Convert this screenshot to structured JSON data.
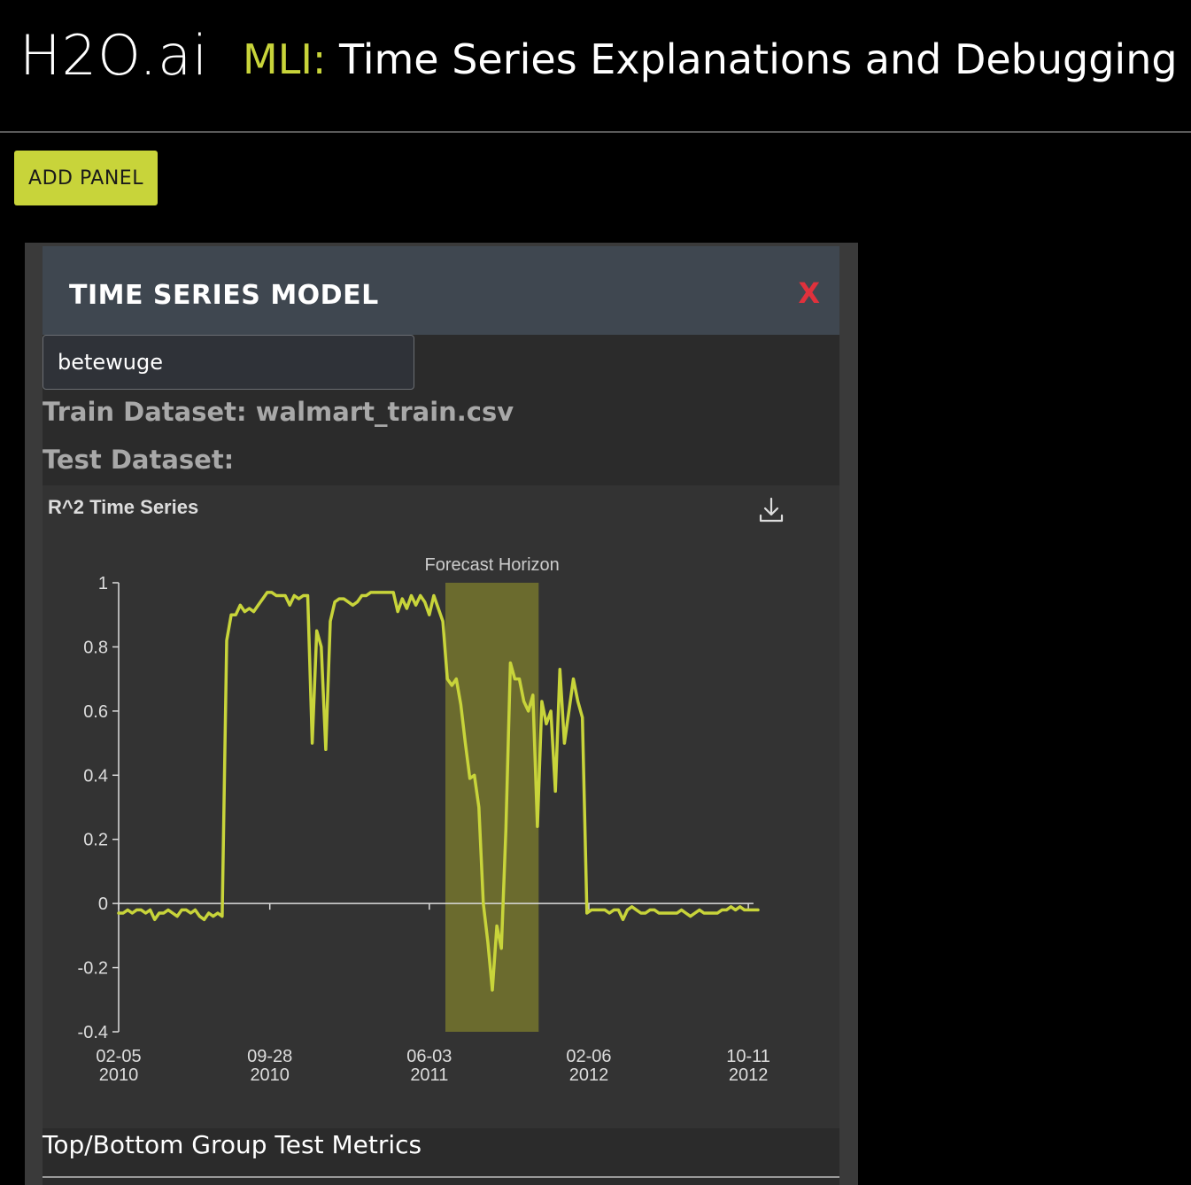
{
  "header": {
    "logo": "H2O.ai",
    "title_prefix": "MLI:",
    "title": " Time Series Explanations and Debugging"
  },
  "toolbar": {
    "add_panel_label": "ADD PANEL"
  },
  "panel": {
    "title": "TIME SERIES MODEL",
    "close_label": "X",
    "model_name": "betewuge",
    "train_dataset": "Train Dataset: walmart_train.csv",
    "test_dataset": "Test Dataset:",
    "footer_title": "Top/Bottom Group Test Metrics"
  },
  "colors": {
    "accent": "#c8d43a",
    "close": "#e0313c",
    "band": "#6b6b2e"
  },
  "icons": {
    "download": "download-icon",
    "close": "close-icon"
  },
  "chart_data": {
    "type": "line",
    "title": "R^2 Time Series",
    "xlabel": "",
    "ylabel": "",
    "ylim": [
      -0.4,
      1
    ],
    "xlim": [
      "2010-02-05",
      "2012-10-26"
    ],
    "yticks": [
      "1",
      "0.8",
      "0.6",
      "0.4",
      "0.2",
      "0",
      "-0.2",
      "-0.4"
    ],
    "ytick_values": [
      1,
      0.8,
      0.6,
      0.4,
      0.2,
      0,
      -0.2,
      -0.4
    ],
    "xticks": [
      {
        "date": "2010-02-05",
        "line1": "02-05",
        "line2": "2010"
      },
      {
        "date": "2010-09-28",
        "line1": "09-28",
        "line2": "2010"
      },
      {
        "date": "2011-06-03",
        "line1": "06-03",
        "line2": "2011"
      },
      {
        "date": "2012-02-06",
        "line1": "02-06",
        "line2": "2012"
      },
      {
        "date": "2012-10-11",
        "line1": "10-11",
        "line2": "2012"
      }
    ],
    "annotation": {
      "label": "Forecast Horizon",
      "start": "2011-06-28",
      "end": "2011-11-20"
    },
    "grid": false,
    "legend": "none",
    "series": [
      {
        "color": "#c8d43a",
        "x": [
          "2010-02-05",
          "2010-02-12",
          "2010-02-19",
          "2010-02-26",
          "2010-03-05",
          "2010-03-12",
          "2010-03-19",
          "2010-03-26",
          "2010-04-02",
          "2010-04-09",
          "2010-04-16",
          "2010-04-23",
          "2010-04-30",
          "2010-05-07",
          "2010-05-14",
          "2010-05-21",
          "2010-05-28",
          "2010-06-04",
          "2010-06-11",
          "2010-06-18",
          "2010-06-25",
          "2010-07-02",
          "2010-07-09",
          "2010-07-16",
          "2010-07-23",
          "2010-07-30",
          "2010-08-06",
          "2010-08-13",
          "2010-08-20",
          "2010-08-27",
          "2010-09-03",
          "2010-09-10",
          "2010-09-17",
          "2010-09-24",
          "2010-10-01",
          "2010-10-08",
          "2010-10-15",
          "2010-10-22",
          "2010-10-29",
          "2010-11-05",
          "2010-11-12",
          "2010-11-19",
          "2010-11-26",
          "2010-12-03",
          "2010-12-10",
          "2010-12-17",
          "2010-12-24",
          "2010-12-31",
          "2011-01-07",
          "2011-01-14",
          "2011-01-21",
          "2011-01-28",
          "2011-02-04",
          "2011-02-11",
          "2011-02-18",
          "2011-02-25",
          "2011-03-04",
          "2011-03-11",
          "2011-03-18",
          "2011-03-25",
          "2011-04-01",
          "2011-04-08",
          "2011-04-15",
          "2011-04-22",
          "2011-04-29",
          "2011-05-06",
          "2011-05-13",
          "2011-05-20",
          "2011-05-27",
          "2011-06-03",
          "2011-06-10",
          "2011-06-17",
          "2011-06-24",
          "2011-07-01",
          "2011-07-08",
          "2011-07-15",
          "2011-07-22",
          "2011-07-29",
          "2011-08-05",
          "2011-08-12",
          "2011-08-19",
          "2011-08-26",
          "2011-09-02",
          "2011-09-09",
          "2011-09-16",
          "2011-09-23",
          "2011-09-30",
          "2011-10-07",
          "2011-10-14",
          "2011-10-21",
          "2011-10-28",
          "2011-11-04",
          "2011-11-11",
          "2011-11-18",
          "2011-11-25",
          "2011-12-02",
          "2011-12-09",
          "2011-12-16",
          "2011-12-23",
          "2011-12-30",
          "2012-01-06",
          "2012-01-13",
          "2012-01-20",
          "2012-01-27",
          "2012-02-03",
          "2012-02-10",
          "2012-02-17",
          "2012-02-24",
          "2012-03-02",
          "2012-03-09",
          "2012-03-16",
          "2012-03-23",
          "2012-03-30",
          "2012-04-06",
          "2012-04-13",
          "2012-04-20",
          "2012-04-27",
          "2012-05-04",
          "2012-05-11",
          "2012-05-18",
          "2012-05-25",
          "2012-06-01",
          "2012-06-08",
          "2012-06-15",
          "2012-06-22",
          "2012-06-29",
          "2012-07-06",
          "2012-07-13",
          "2012-07-20",
          "2012-07-27",
          "2012-08-03",
          "2012-08-10",
          "2012-08-17",
          "2012-08-24",
          "2012-08-31",
          "2012-09-07",
          "2012-09-14",
          "2012-09-21",
          "2012-09-28",
          "2012-10-05",
          "2012-10-12",
          "2012-10-19",
          "2012-10-26"
        ],
        "y": [
          -0.03,
          -0.03,
          -0.02,
          -0.03,
          -0.02,
          -0.02,
          -0.03,
          -0.02,
          -0.05,
          -0.03,
          -0.03,
          -0.02,
          -0.03,
          -0.04,
          -0.02,
          -0.02,
          -0.03,
          -0.02,
          -0.04,
          -0.05,
          -0.03,
          -0.04,
          -0.03,
          -0.04,
          0.82,
          0.9,
          0.9,
          0.93,
          0.91,
          0.92,
          0.91,
          0.93,
          0.95,
          0.97,
          0.97,
          0.96,
          0.96,
          0.96,
          0.93,
          0.96,
          0.95,
          0.96,
          0.96,
          0.5,
          0.85,
          0.8,
          0.48,
          0.88,
          0.94,
          0.95,
          0.95,
          0.94,
          0.93,
          0.94,
          0.96,
          0.96,
          0.97,
          0.97,
          0.97,
          0.97,
          0.97,
          0.97,
          0.91,
          0.95,
          0.92,
          0.96,
          0.93,
          0.96,
          0.94,
          0.9,
          0.96,
          0.92,
          0.88,
          0.7,
          0.68,
          0.7,
          0.62,
          0.5,
          0.39,
          0.4,
          0.3,
          0.0,
          -0.12,
          -0.27,
          -0.07,
          -0.14,
          0.23,
          0.75,
          0.7,
          0.7,
          0.63,
          0.6,
          0.65,
          0.24,
          0.63,
          0.56,
          0.6,
          0.35,
          0.73,
          0.5,
          0.6,
          0.7,
          0.63,
          0.58,
          -0.03,
          -0.02,
          -0.02,
          -0.02,
          -0.02,
          -0.03,
          -0.02,
          -0.02,
          -0.05,
          -0.02,
          -0.01,
          -0.02,
          -0.03,
          -0.03,
          -0.02,
          -0.02,
          -0.03,
          -0.03,
          -0.03,
          -0.03,
          -0.03,
          -0.02,
          -0.03,
          -0.04,
          -0.03,
          -0.02,
          -0.03,
          -0.03,
          -0.03,
          -0.03,
          -0.02,
          -0.02,
          -0.01,
          -0.02,
          -0.01,
          -0.02,
          -0.02,
          -0.02,
          -0.02
        ]
      }
    ]
  }
}
